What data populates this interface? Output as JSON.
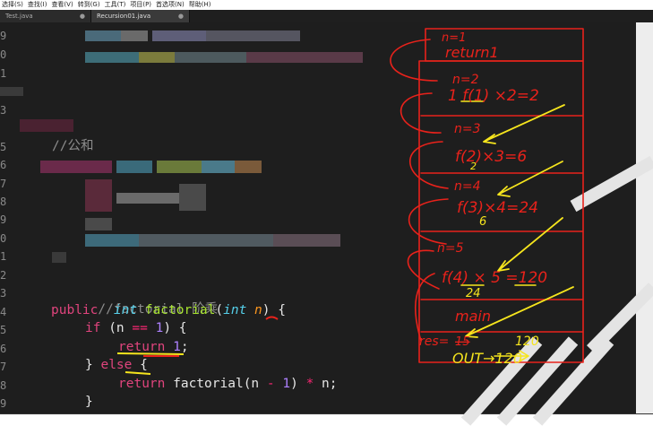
{
  "menu": [
    "选择(S)",
    "查找(I)",
    "查看(V)",
    "转到(G)",
    "工具(T)",
    "项目(P)",
    "首选项(N)",
    "帮助(H)"
  ],
  "tabs": [
    {
      "label": "Test.java",
      "close": "●"
    },
    {
      "label": "Recursion01.java",
      "close": "●"
    }
  ],
  "line_numbers": [
    "9",
    "0",
    "1",
    "",
    "3",
    "",
    "5",
    "6",
    "7",
    "8",
    "9",
    "0",
    "1",
    "2",
    "3",
    "4",
    "5",
    "6",
    "7",
    "8",
    "9"
  ],
  "code": {
    "blur_comment": "//公和",
    "comment": "//factorial 阶乘",
    "kw_public": "public",
    "kw_int": "int",
    "fn_name": "factorial",
    "param_n": "n",
    "kw_if": "if",
    "if_open": " (n ",
    "eq": "==",
    "one": "1",
    "if_close": ") {",
    "kw_return": "return",
    "ret_semicolon": ";",
    "else_close": "} ",
    "kw_else": "else",
    "else_brace": " {",
    "return_expr_a": " factorial(n ",
    "minus": "-",
    "return_expr_b": ") ",
    "times": "*",
    "return_expr_c": " n;",
    "close_brace": "}",
    "open_paren": "(",
    "space": " ",
    "close_sig": ") {"
  },
  "annotations": {
    "n1": "n=1",
    "return1": "return1",
    "n2": "n=2",
    "line1": "1 f(1) ×2=2",
    "n3": "n=3",
    "line2": "f(2)×3=6",
    "line2_sub": "2",
    "n4": "n=4",
    "line3": "f(3)×4=24",
    "line3_sub": "6",
    "n5": "n=5",
    "line4": "f(4) × 5 =120",
    "line4_sub": "24",
    "main": "main",
    "res": "res=",
    "res_val": "120",
    "res_strike": "15",
    "out": "OUT→120",
    "color": "#e8221b",
    "yellow": "#f6e51d"
  }
}
